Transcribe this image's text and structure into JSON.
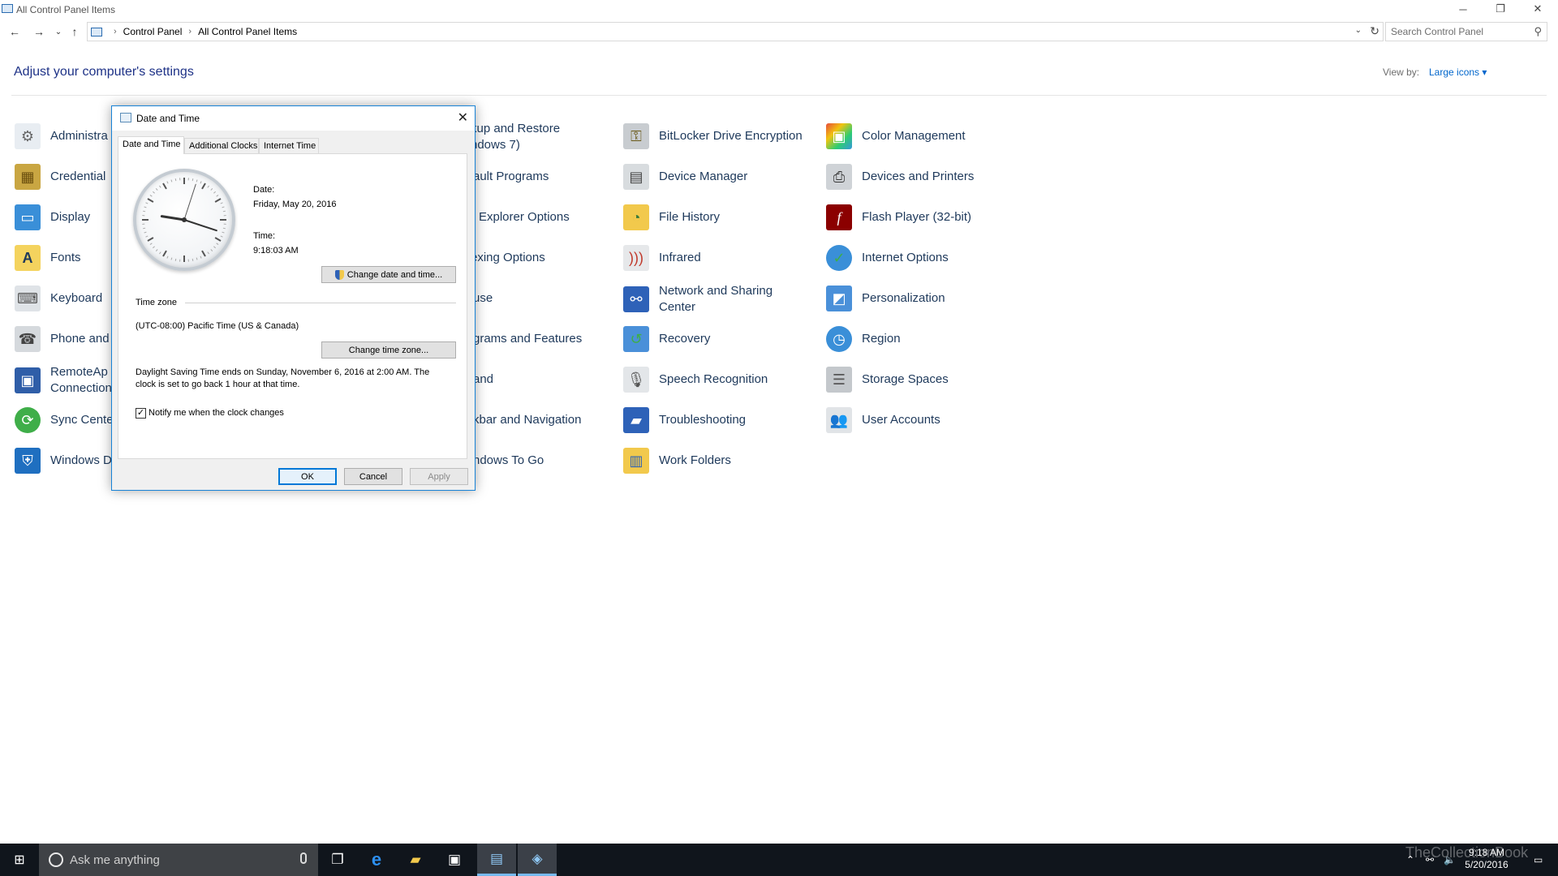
{
  "window": {
    "title": "All Control Panel Items",
    "minimize": "─",
    "maximize": "❐",
    "close": "✕"
  },
  "nav": {
    "back": "←",
    "forward": "→",
    "recent": "⌄",
    "up": "↑"
  },
  "address": {
    "crumbs": [
      "Control Panel",
      "All Control Panel Items"
    ],
    "separator": "›",
    "dropdown": "⌄",
    "refresh": "↻"
  },
  "search": {
    "placeholder": "Search Control Panel",
    "icon": "⚲"
  },
  "header": {
    "title": "Adjust your computer's settings",
    "view_by_label": "View by:",
    "view_by_value": "Large icons ▾"
  },
  "items": {
    "col1": [
      "Administra",
      "Credential",
      "Display",
      "Fonts",
      "Keyboard",
      "Phone and",
      "RemoteAp",
      "Connection",
      "Sync Cente",
      "Windows D"
    ],
    "col2": [
      "kup and Restore",
      "ndows 7)",
      "ault Programs",
      "Explorer Options",
      "exing Options",
      "use",
      "grams and Features",
      "and",
      "kbar and Navigation",
      "ndows To Go"
    ],
    "col3": [
      "BitLocker Drive Encryption",
      "Device Manager",
      "File History",
      "Infrared",
      "Network and Sharing",
      "Center",
      "Recovery",
      "Speech Recognition",
      "Troubleshooting",
      "Work Folders"
    ],
    "col4": [
      "Color Management",
      "Devices and Printers",
      "Flash Player (32-bit)",
      "Internet Options",
      "Personalization",
      "Region",
      "Storage Spaces",
      "User Accounts"
    ]
  },
  "dialog": {
    "title": "Date and Time",
    "close": "✕",
    "tabs": [
      "Date and Time",
      "Additional Clocks",
      "Internet Time"
    ],
    "date_label": "Date:",
    "date_value": "Friday, May 20, 2016",
    "time_label": "Time:",
    "time_value": "9:18:03 AM",
    "change_datetime_button": "Change date and time...",
    "timezone_label": "Time zone",
    "timezone_value": "(UTC-08:00) Pacific Time (US & Canada)",
    "change_timezone_button": "Change time zone...",
    "dst_line1": "Daylight Saving Time ends on Sunday, November 6, 2016 at 2:00 AM. The",
    "dst_line2": "clock is set to go back 1 hour at that time.",
    "notify_checkbox": "Notify me when the clock changes",
    "notify_checked": true,
    "check_glyph": "✓",
    "ok_button": "OK",
    "cancel_button": "Cancel",
    "apply_button": "Apply",
    "clock_time": {
      "hour": 9,
      "minute": 18,
      "second": 3
    }
  },
  "taskbar": {
    "search_placeholder": "Ask me anything",
    "start_icon": "⊞",
    "task_view_icon": "❐",
    "edge_icon": "e",
    "explorer_icon": "▰",
    "store_icon": "▣",
    "control_panel_icon": "▤",
    "datetime_app_icon": "◈",
    "tray_up": "⌃",
    "network_icon": "⚯",
    "volume_icon": "🔈",
    "notification_icon": "▭",
    "time": "9:18 AM",
    "date": "5/20/2016"
  },
  "watermark": "TheCollectionBook",
  "colors": {
    "accent": "#0078d7",
    "link": "#1e395b",
    "heading": "#1e3287",
    "taskbar": "#10151c"
  }
}
